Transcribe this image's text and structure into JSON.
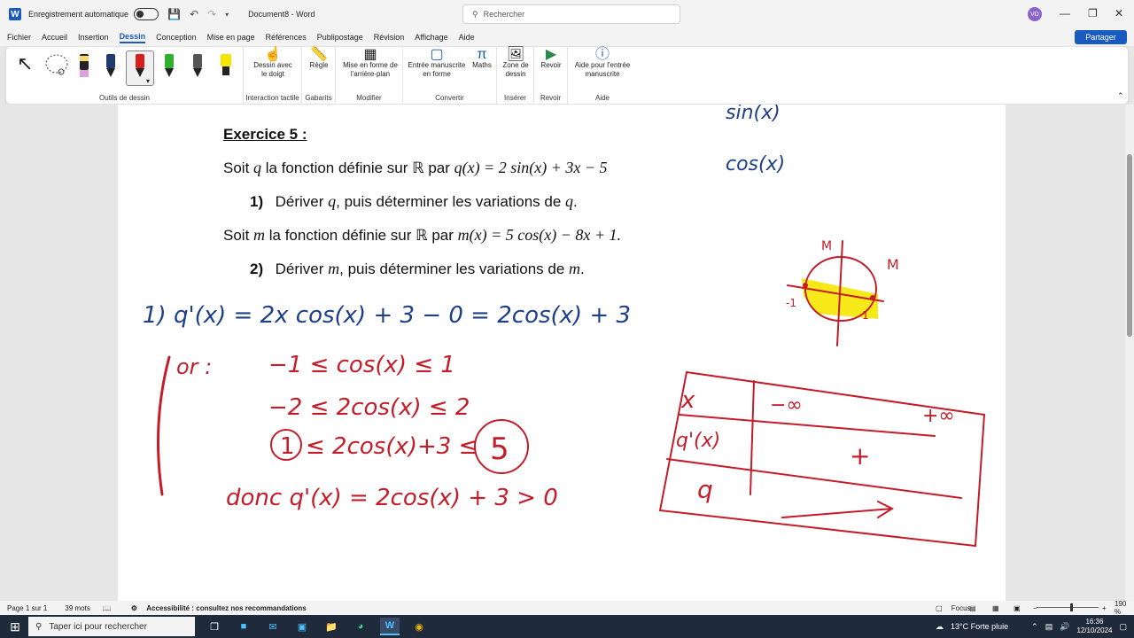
{
  "titlebar": {
    "autosave_label": "Enregistrement automatique",
    "doc_title": "Document8 - Word",
    "search_placeholder": "Rechercher",
    "avatar_initials": "VD"
  },
  "menu": {
    "items": [
      "Fichier",
      "Accueil",
      "Insertion",
      "Dessin",
      "Conception",
      "Mise en page",
      "Références",
      "Publipostage",
      "Révision",
      "Affichage",
      "Aide"
    ],
    "active": "Dessin",
    "share_label": "Partager"
  },
  "ribbon": {
    "groups": {
      "drawing_tools": "Outils de dessin",
      "touch": "Interaction tactile",
      "stencils": "Gabarits",
      "modify": "Modifier",
      "convert": "Convertir",
      "insert": "Insérer",
      "replay": "Revoir",
      "help": "Aide"
    },
    "buttons": {
      "draw_finger_1": "Dessin avec",
      "draw_finger_2": "le doigt",
      "ruler": "Règle",
      "background_1": "Mise en forme de",
      "background_2": "l'arrière-plan",
      "ink_shape_1": "Entrée manuscrite",
      "ink_shape_2": "en forme",
      "math": "Maths",
      "canvas_1": "Zone de",
      "canvas_2": "dessin",
      "replay": "Revoir",
      "ink_help_1": "Aide pour l'entrée",
      "ink_help_2": "manuscrite"
    },
    "pen_colors": [
      "#e0a0e0",
      "#1f3a6e",
      "#d81e1e",
      "#2fae2f",
      "#555555",
      "#f5e600"
    ]
  },
  "document": {
    "title": "Exercice 5 :",
    "line1_a": "Soit ",
    "line1_var": "q",
    "line1_b": " la fonction définie sur ℝ par ",
    "line1_math": "q(x) = 2 sin(x) + 3x − 5",
    "q1_num": "1)",
    "q1_a": "Dériver ",
    "q1_var": "q",
    "q1_b": ", puis déterminer les variations de ",
    "q1_var2": "q",
    "q1_end": ".",
    "line2_a": "Soit ",
    "line2_var": "m",
    "line2_b": " la fonction définie sur ℝ par ",
    "line2_math": "m(x) = 5 cos(x) − 8x + 1.",
    "q2_num": "2)",
    "q2_a": "Dériver ",
    "q2_var": "m",
    "q2_b": ", puis déterminer les variations de ",
    "q2_var2": "m",
    "q2_end": "."
  },
  "ink": {
    "sin": "sin(x)",
    "cos": "cos(x)",
    "deriv": "1)  q'(x) = 2x cos(x) + 3 − 0  =  2cos(x) + 3",
    "or_label": "or :",
    "ineq1": "−1 ≤ cos(x) ≤ 1",
    "ineq2": "−2 ≤ 2cos(x) ≤ 2",
    "ineq3_a": "1",
    "ineq3_b": "≤ 2cos(x)+3 ≤",
    "ineq3_c": "5",
    "conclusion": "donc q'(x) = 2cos(x) + 3 > 0",
    "circle_M1": "M",
    "circle_M2": "M",
    "circle_m1": "-1",
    "circle_1": "1",
    "table_x": "x",
    "table_minf": "−∞",
    "table_pinf": "+∞",
    "table_qp": "q'(x)",
    "table_sign": "+",
    "table_q": "q"
  },
  "status": {
    "page": "Page 1 sur 1",
    "words": "39 mots",
    "accessibility": "Accessibilité : consultez nos recommandations",
    "focus": "Focus",
    "zoom": "190 %"
  },
  "taskbar": {
    "search_placeholder": "Taper ici pour rechercher",
    "weather": "13°C  Forte pluie",
    "time": "16:36",
    "date": "12/10/2024"
  }
}
